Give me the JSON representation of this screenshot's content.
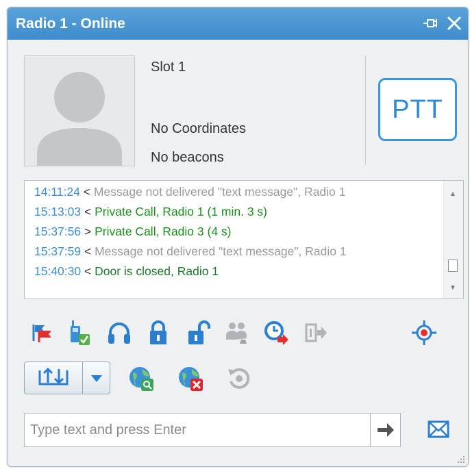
{
  "window": {
    "title": "Radio 1 - Online",
    "pin_icon": "pin-icon",
    "close_icon": "close-icon"
  },
  "header": {
    "slot": "Slot 1",
    "coordinates": "No Coordinates",
    "beacons": "No beacons",
    "ptt_label": "PTT",
    "avatar_icon": "user-avatar-icon"
  },
  "log": {
    "entries": [
      {
        "time": "14:11:24",
        "dir": "<",
        "text": "Message not delivered \"text message\", Radio 1",
        "status": "gray"
      },
      {
        "time": "15:13:03",
        "dir": "<",
        "text": "Private Call, Radio 1 (1 min. 3 s)",
        "status": "green"
      },
      {
        "time": "15:37:56",
        "dir": ">",
        "text": "Private Call, Radio 3 (4 s)",
        "status": "green"
      },
      {
        "time": "15:37:59",
        "dir": "<",
        "text": "Message not delivered \"text message\", Radio 1",
        "status": "gray"
      },
      {
        "time": "15:40:30",
        "dir": "<",
        "text": "Door is closed, Radio 1",
        "status": "dark-green"
      }
    ]
  },
  "toolbar": {
    "row1": [
      "radio-check-flags-icon",
      "radio-enabled-icon",
      "headset-icon",
      "lock-icon",
      "unlock-icon",
      "group-call-icon",
      "scheduled-call-icon",
      "exit-icon",
      "target-location-icon"
    ],
    "row2": [
      "upload-split-button-icon",
      "dropdown-arrow-icon",
      "location-search-icon",
      "location-cancel-icon",
      "replay-icon"
    ]
  },
  "composer": {
    "placeholder": "Type text and press Enter",
    "send_icon": "send-arrow-icon",
    "mail_icon": "envelope-icon"
  },
  "colors": {
    "titlebar": "#4a98d4",
    "accent": "#2c8ad6",
    "log_time": "#3d8ed4",
    "log_gray": "#9a9a9a",
    "log_green": "#1c8f1c"
  }
}
